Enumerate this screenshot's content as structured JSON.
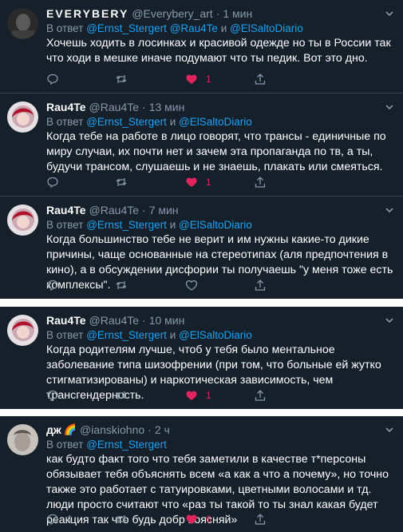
{
  "reply_prefix": "В ответ",
  "and_word": "и",
  "tweets": [
    {
      "name": "EVERYBERY",
      "handle": "@Everybery_art",
      "time": "1 мин",
      "reply_to": [
        "@Ernst_Stergert",
        "@Rau4Te",
        "@ElSaltoDiario"
      ],
      "text": "Хочешь ходить в лосинках и красивой одежде но ты в России так что ходи в мешке иначе подумают что ты педик. Вот это дно.",
      "replies": "",
      "retweets": "",
      "likes": "1",
      "liked": true
    },
    {
      "name": "Rau4Te",
      "handle": "@Rau4Te",
      "time": "13 мин",
      "reply_to": [
        "@Ernst_Stergert",
        "@ElSaltoDiario"
      ],
      "text": "Когда тебе на работе в лицо говорят, что трансы - единичные по миру случаи, их почти нет и зачем эта пропаганда по тв, а ты, будучи трансом, слушаешь и не знаешь, плакать или смеяться.",
      "replies": "",
      "retweets": "",
      "likes": "1",
      "liked": true
    },
    {
      "name": "Rau4Te",
      "handle": "@Rau4Te",
      "time": "7 мин",
      "reply_to": [
        "@Ernst_Stergert",
        "@ElSaltoDiario"
      ],
      "text": "Когда большинство тебе не верит и им нужны какие-то дикие причины, чаще основанные на стереотипах (аля предпочтения в кино), а в обсуждении дисфории ты получаешь \"у меня тоже есть комплексы\".",
      "replies": "",
      "retweets": "",
      "likes": "",
      "liked": false
    },
    {
      "name": "Rau4Te",
      "handle": "@Rau4Te",
      "time": "10 мин",
      "reply_to": [
        "@Ernst_Stergert",
        "@ElSaltoDiario"
      ],
      "text": "Когда родителям лучше, чтоб у тебя было ментальное заболевание типа шизофрении (при том, что больные ей жутко стигматизированы) и наркотическая зависимость, чем трансгендерность.",
      "replies": "",
      "retweets": "",
      "likes": "1",
      "liked": true
    },
    {
      "name": "дж",
      "name_emoji": "🌈",
      "handle": "@ianskiohno",
      "time": "2 ч",
      "reply_to": [
        "@Ernst_Stergert"
      ],
      "text": "как будто факт того что тебя заметили в качестве т*персоны обязывает тебя объяснять всем «а как а что а почему», но точно также это работает с татуировками, цветными волосами и тд. люди просто считают что «раз ты такой то ты знал какая будет реакция так что будь добр поясняй»",
      "replies": "1",
      "retweets": "",
      "likes": "6",
      "liked": true
    }
  ],
  "colors": {
    "background": "#15202b",
    "link": "#1da1f2",
    "muted": "#8899a6",
    "like": "#e0245e",
    "separator": "#ffffff"
  },
  "icons": [
    "reply-icon",
    "retweet-icon",
    "like-icon",
    "share-icon",
    "caret-down-icon"
  ]
}
